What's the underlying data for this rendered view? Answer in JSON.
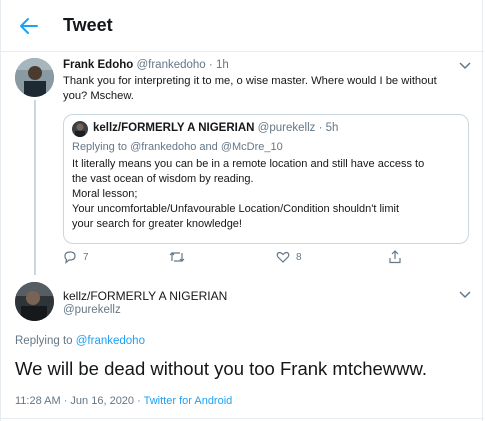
{
  "header": {
    "title": "Tweet"
  },
  "parent_tweet": {
    "name": "Frank Edoho",
    "handle": "@frankedoho",
    "separator": "·",
    "time": "1h",
    "text_line1": "Thank you for interpreting it to me, o wise master. Where would I be without",
    "text_line2": "you? Mschew.",
    "quoted": {
      "name": "kellz/FORMERLY A NIGERIAN",
      "handle": "@purekellz",
      "separator": "·",
      "time": "5h",
      "replying_prefix": "Replying to",
      "replying_user1": "@frankedoho",
      "replying_and": "and",
      "replying_user2": "@McDre_10",
      "lines": [
        "It literally means you can be in a remote location and still have access to",
        "the vast ocean of wisdom by reading.",
        "Moral lesson;",
        "Your uncomfortable/Unfavourable  Location/Condition shouldn't limit",
        "your search for greater knowledge!"
      ]
    },
    "actions": {
      "reply_count": "7",
      "retweet_count": "",
      "like_count": "8"
    }
  },
  "main_tweet": {
    "name": "kellz/FORMERLY A NIGERIAN",
    "handle": "@purekellz",
    "replying_prefix": "Replying to",
    "replying_user": "@frankedoho",
    "text": "We will be dead without you too Frank mtchewww.",
    "timestamp": "11:28 AM · Jun 16, 2020 · ",
    "source": "Twitter for Android"
  },
  "colors": {
    "accent": "#1da1f2",
    "muted": "#657786",
    "border": "#e6ecf0"
  }
}
